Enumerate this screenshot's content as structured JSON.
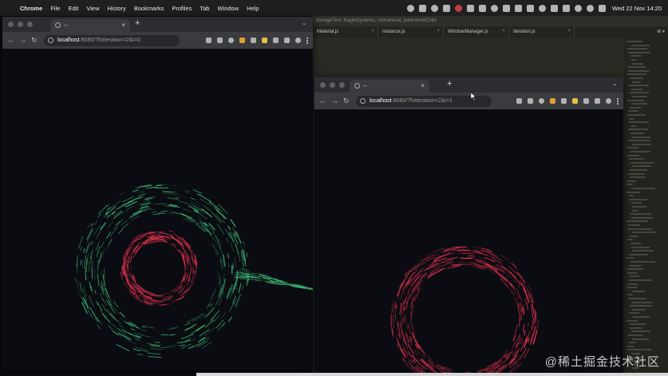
{
  "menubar": {
    "app": "Chrome",
    "items": [
      "File",
      "Edit",
      "View",
      "History",
      "Bookmarks",
      "Profiles",
      "Tab",
      "Window",
      "Help"
    ],
    "clock": "Wed 22 Nov  14:20"
  },
  "editor": {
    "path": "storageTest, fragileSystems, Unmaterial, parentAndChild",
    "tabs": [
      "Material.js",
      "Instance.js",
      "WindowManager.js",
      "Iteration.js"
    ],
    "tab_controls": "⊞ ▾"
  },
  "left_browser": {
    "tab_title": "--",
    "url_host": "localhost",
    "url_rest": ":8080/?fxIteration=2&i=0"
  },
  "right_browser": {
    "tab_title": "--",
    "url_host": "localhost",
    "url_rest": ":8080/?fxIteration=2&i=1"
  },
  "watermark": "@稀土掘金技术社区",
  "colors": {
    "green_orb": "#3fbf7a",
    "red_orb": "#d8304a",
    "page_bg": "#0b0c12"
  }
}
